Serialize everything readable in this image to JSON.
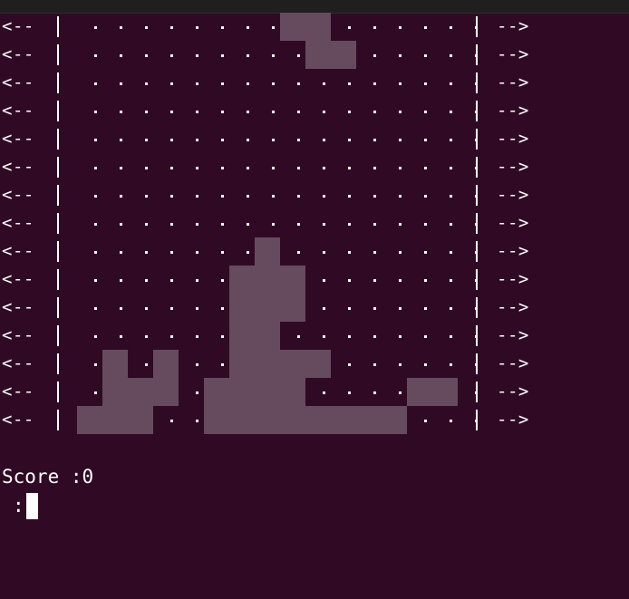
{
  "terminal": {
    "background": "#300a24",
    "foreground": "#ffffff",
    "block_color": "#664b5e"
  },
  "board": {
    "left_label": "<--",
    "right_label": "-->",
    "rows": [
      "        ##      ",
      "         ##     ",
      "                ",
      "                ",
      "                ",
      "                ",
      "                ",
      "                ",
      "       #        ",
      "      ###       ",
      "      ###       ",
      "      ##        ",
      " # #  ####      ",
      " ### ####    ## ",
      "###  ########   "
    ]
  },
  "status": {
    "score_label": "Score :",
    "score_value": "0",
    "prompt": ":"
  }
}
